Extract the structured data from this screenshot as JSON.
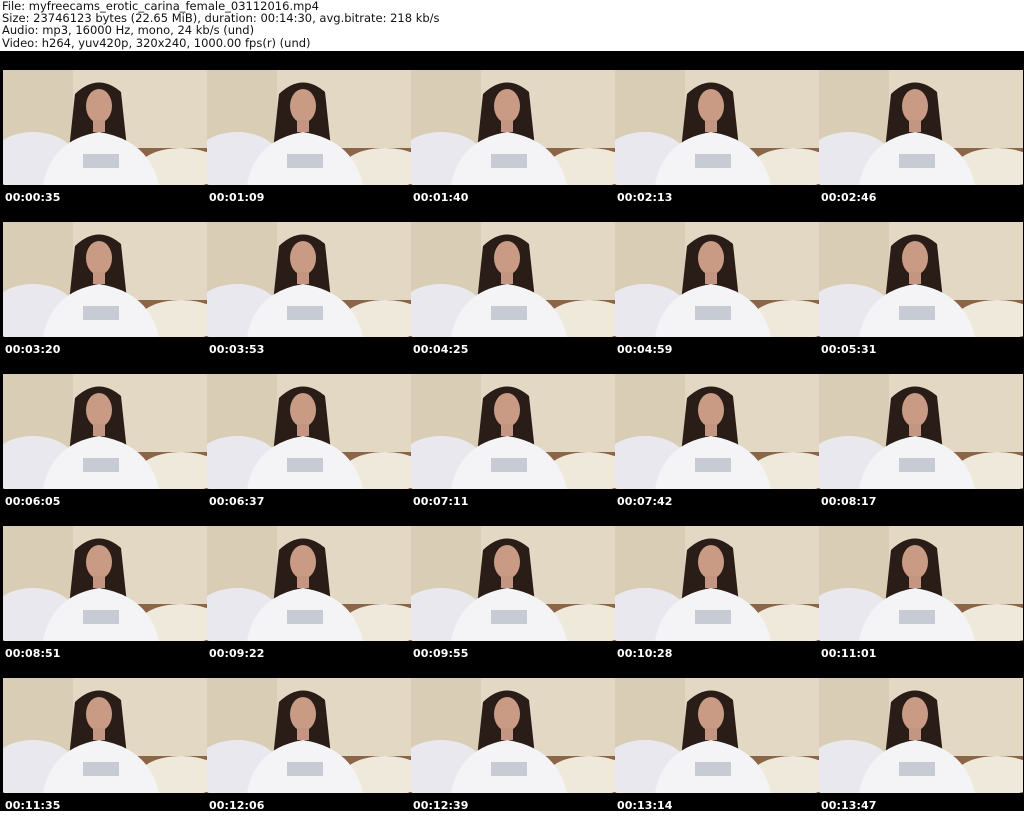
{
  "header": {
    "file": "File: myfreecams_erotic_carina_female_03112016.mp4",
    "size": "Size: 23746123 bytes (22.65 MiB), duration: 00:14:30, avg.bitrate: 218 kb/s",
    "audio": "Audio: mp3, 16000 Hz, mono, 24 kb/s (und)",
    "video": "Video: h264, yuv420p, 320x240, 1000.00 fps(r) (und)"
  },
  "grid": {
    "columns": 5,
    "rows": 5,
    "timestamps": [
      "00:00:35",
      "00:01:09",
      "00:01:40",
      "00:02:13",
      "00:02:46",
      "00:03:20",
      "00:03:53",
      "00:04:25",
      "00:04:59",
      "00:05:31",
      "00:06:05",
      "00:06:37",
      "00:07:11",
      "00:07:42",
      "00:08:17",
      "00:08:51",
      "00:09:22",
      "00:09:55",
      "00:10:28",
      "00:11:01",
      "00:11:35",
      "00:12:06",
      "00:12:39",
      "00:13:14",
      "00:13:47"
    ]
  }
}
